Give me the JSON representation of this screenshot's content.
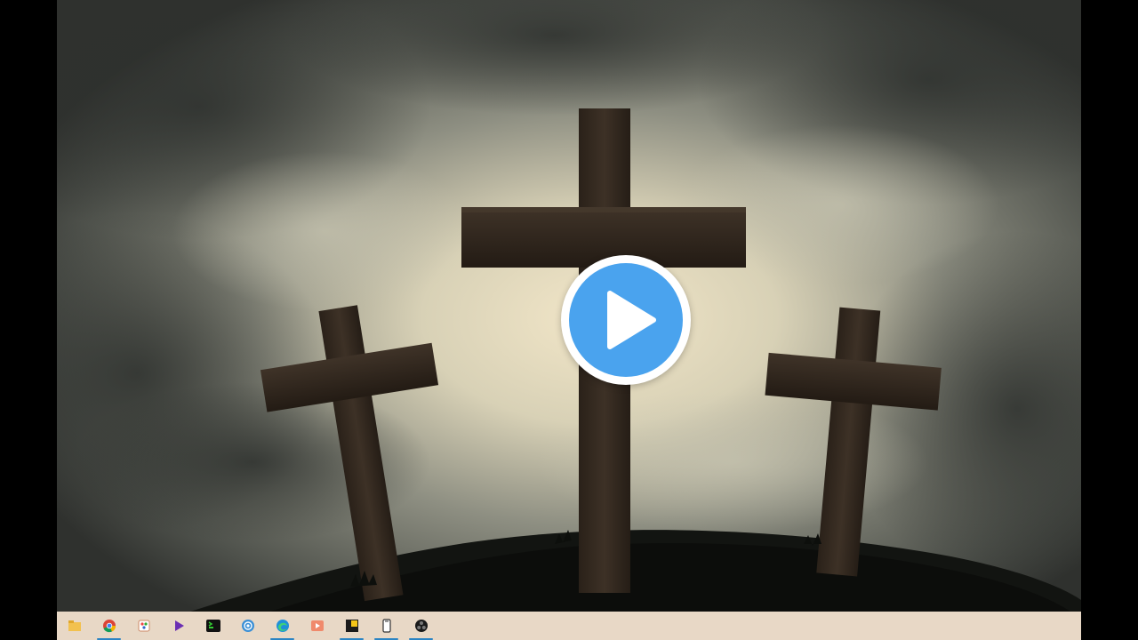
{
  "video": {
    "scene": "three-crosses-on-hill",
    "play_button": {
      "icon": "play-icon",
      "ring_color": "#ffffff",
      "fill_color": "#4aa3ee",
      "triangle_color": "#ffffff"
    }
  },
  "taskbar": {
    "background": "#e8d8c6",
    "indicator_color": "#2a84c4",
    "items": [
      {
        "icon": "file-explorer-icon",
        "active": false
      },
      {
        "icon": "chrome-icon",
        "active": true
      },
      {
        "icon": "paint-app-icon",
        "active": false
      },
      {
        "icon": "media-player-icon",
        "active": false
      },
      {
        "icon": "terminal-icon",
        "active": false
      },
      {
        "icon": "settings-globe-icon",
        "active": false
      },
      {
        "icon": "edge-icon",
        "active": true
      },
      {
        "icon": "media-app-icon",
        "active": false
      },
      {
        "icon": "sticky-notes-icon",
        "active": true
      },
      {
        "icon": "phone-icon",
        "active": true
      },
      {
        "icon": "obs-icon",
        "active": true
      }
    ]
  }
}
